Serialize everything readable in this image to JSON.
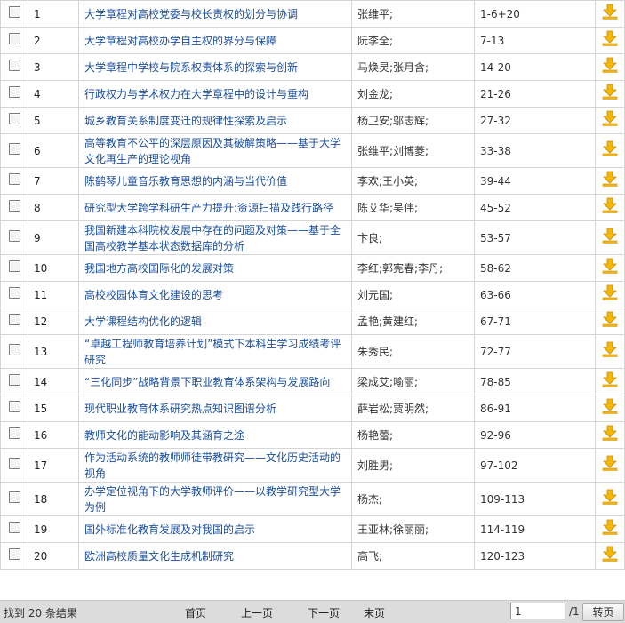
{
  "rows": [
    {
      "num": "1",
      "title": "大学章程对高校党委与校长责权的划分与协调",
      "authors": "张维平;",
      "pages": "1-6+20"
    },
    {
      "num": "2",
      "title": "大学章程对高校办学自主权的界分与保障",
      "authors": "阮李全;",
      "pages": "7-13"
    },
    {
      "num": "3",
      "title": "大学章程中学校与院系权责体系的探索与创新",
      "authors": "马焕灵;张月含;",
      "pages": "14-20"
    },
    {
      "num": "4",
      "title": "行政权力与学术权力在大学章程中的设计与重构",
      "authors": "刘金龙;",
      "pages": "21-26"
    },
    {
      "num": "5",
      "title": "城乡教育关系制度变迁的规律性探索及启示",
      "authors": "杨卫安;邬志辉;",
      "pages": "27-32"
    },
    {
      "num": "6",
      "title": "高等教育不公平的深层原因及其破解策略——基于大学文化再生产的理论视角",
      "authors": "张维平;刘博菱;",
      "pages": "33-38"
    },
    {
      "num": "7",
      "title": "陈鹤琴儿童音乐教育思想的内涵与当代价值",
      "authors": "李欢;王小英;",
      "pages": "39-44"
    },
    {
      "num": "8",
      "title": "研究型大学跨学科研生产力提升:资源扫描及践行路径",
      "authors": "陈艾华;吴伟;",
      "pages": "45-52"
    },
    {
      "num": "9",
      "title": "我国新建本科院校发展中存在的问题及对策——基于全国高校教学基本状态数据库的分析",
      "authors": "卞良;",
      "pages": "53-57"
    },
    {
      "num": "10",
      "title": "我国地方高校国际化的发展对策",
      "authors": "李红;郭宪春;李丹;",
      "pages": "58-62"
    },
    {
      "num": "11",
      "title": "高校校园体育文化建设的思考",
      "authors": "刘元国;",
      "pages": "63-66"
    },
    {
      "num": "12",
      "title": "大学课程结构优化的逻辑",
      "authors": "孟艳;黄建红;",
      "pages": "67-71"
    },
    {
      "num": "13",
      "title": "“卓越工程师教育培养计划”模式下本科生学习成绩考评研究",
      "authors": "朱秀民;",
      "pages": "72-77"
    },
    {
      "num": "14",
      "title": "“三化同步”战略背景下职业教育体系架构与发展路向",
      "authors": "梁成艾;喻丽;",
      "pages": "78-85"
    },
    {
      "num": "15",
      "title": "现代职业教育体系研究热点知识图谱分析",
      "authors": "薛岩松;贾明然;",
      "pages": "86-91"
    },
    {
      "num": "16",
      "title": "教师文化的能动影响及其涵育之途",
      "authors": "杨艳蕾;",
      "pages": "92-96"
    },
    {
      "num": "17",
      "title": "作为活动系统的教师师徒带教研究——文化历史活动的视角",
      "authors": "刘胜男;",
      "pages": "97-102"
    },
    {
      "num": "18",
      "title": "办学定位视角下的大学教师评价——以教学研究型大学为例",
      "authors": "杨杰;",
      "pages": "109-113"
    },
    {
      "num": "19",
      "title": "国外标准化教育发展及对我国的启示",
      "authors": "王亚林;徐丽丽;",
      "pages": "114-119"
    },
    {
      "num": "20",
      "title": "欧洲高校质量文化生成机制研究",
      "authors": "高飞;",
      "pages": "120-123"
    }
  ],
  "footer": {
    "found_text": "找到 20 条结果",
    "first": "首页",
    "prev": "上一页",
    "next": "下一页",
    "last": "末页",
    "page_value": "1",
    "total_pages": "/1",
    "go_button": "转页"
  },
  "colors": {
    "link": "#1a4e9c",
    "download_icon": "#f2b705"
  },
  "icons": {
    "download": "download-icon",
    "checkbox": "checkbox"
  }
}
